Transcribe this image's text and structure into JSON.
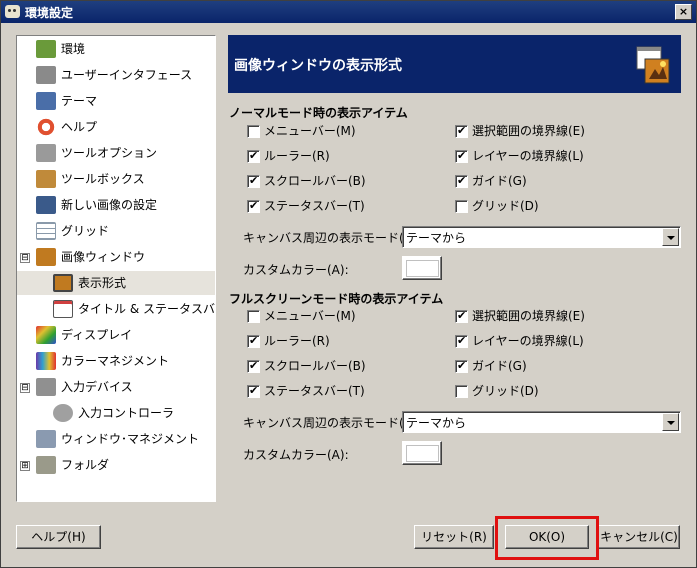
{
  "window": {
    "title": "環境設定",
    "close_label": "×"
  },
  "tree": [
    {
      "label": "環境",
      "icon": "environment-icon",
      "color": "#6a9a3a"
    },
    {
      "label": "ユーザーインタフェース",
      "icon": "user-interface-icon",
      "color": "#8a8a8a"
    },
    {
      "label": "テーマ",
      "icon": "theme-icon",
      "color": "#4a6ea8"
    },
    {
      "label": "ヘルプ",
      "icon": "help-lifebuoy-icon",
      "color": "#e05030"
    },
    {
      "label": "ツールオプション",
      "icon": "tool-options-icon",
      "color": "#9a9a9a"
    },
    {
      "label": "ツールボックス",
      "icon": "toolbox-icon",
      "color": "#c08a3a"
    },
    {
      "label": "新しい画像の設定",
      "icon": "new-image-icon",
      "color": "#3a5a8a"
    },
    {
      "label": "グリッド",
      "icon": "grid-icon",
      "color": "#8a9aaa"
    },
    {
      "label": "画像ウィンドウ",
      "icon": "image-window-icon",
      "color": "#c07a20"
    },
    {
      "label": "表示形式",
      "icon": "appearance-icon",
      "color": "#c07a20"
    },
    {
      "label": "タイトル & ステータスバー",
      "icon": "title-statusbar-icon",
      "color": "#d04040"
    },
    {
      "label": "ディスプレイ",
      "icon": "display-icon",
      "color": "#3a8a3a"
    },
    {
      "label": "カラーマネジメント",
      "icon": "color-management-icon",
      "color": "#6a3aaa"
    },
    {
      "label": "入力デバイス",
      "icon": "input-devices-icon",
      "color": "#909090"
    },
    {
      "label": "入力コントローラ",
      "icon": "input-controllers-icon",
      "color": "#a0a0a0"
    },
    {
      "label": "ウィンドウ･マネジメント",
      "icon": "window-management-icon",
      "color": "#8a9ab0"
    },
    {
      "label": "フォルダ",
      "icon": "folders-icon",
      "color": "#9a9a8a"
    }
  ],
  "tree_expanders": {
    "image_window": "⊟",
    "input_devices": "⊟",
    "folders": "⊞"
  },
  "header": {
    "title": "画像ウィンドウの表示形式",
    "icon": "image-window-appearance-icon"
  },
  "normal": {
    "section_title": "ノーマルモード時の表示アイテム",
    "left": [
      {
        "label": "メニューバー(M)",
        "checked": false
      },
      {
        "label": "ルーラー(R)",
        "checked": true
      },
      {
        "label": "スクロールバー(B)",
        "checked": true
      },
      {
        "label": "ステータスバー(T)",
        "checked": true
      }
    ],
    "right": [
      {
        "label": "選択範囲の境界線(E)",
        "checked": true
      },
      {
        "label": "レイヤーの境界線(L)",
        "checked": true
      },
      {
        "label": "ガイド(G)",
        "checked": true
      },
      {
        "label": "グリッド(D)",
        "checked": false
      }
    ],
    "padding_mode_label": "キャンバス周辺の表示モード(P):",
    "padding_mode_value": "テーマから",
    "custom_color_label": "カスタムカラー(A):"
  },
  "fullscreen": {
    "section_title": "フルスクリーンモード時の表示アイテム",
    "left": [
      {
        "label": "メニューバー(M)",
        "checked": false
      },
      {
        "label": "ルーラー(R)",
        "checked": true
      },
      {
        "label": "スクロールバー(B)",
        "checked": true
      },
      {
        "label": "ステータスバー(T)",
        "checked": true
      }
    ],
    "right": [
      {
        "label": "選択範囲の境界線(E)",
        "checked": true
      },
      {
        "label": "レイヤーの境界線(L)",
        "checked": true
      },
      {
        "label": "ガイド(G)",
        "checked": true
      },
      {
        "label": "グリッド(D)",
        "checked": false
      }
    ],
    "padding_mode_label": "キャンバス周辺の表示モード(P):",
    "padding_mode_value": "テーマから",
    "custom_color_label": "カスタムカラー(A):"
  },
  "buttons": {
    "help": "ヘルプ(H)",
    "reset": "リセット(R)",
    "ok": "OK(O)",
    "cancel": "キャンセル(C)"
  },
  "colors": {
    "header_bg": "#0a246a",
    "highlight": "#e01010",
    "selected_row": "#e6e3dc"
  }
}
